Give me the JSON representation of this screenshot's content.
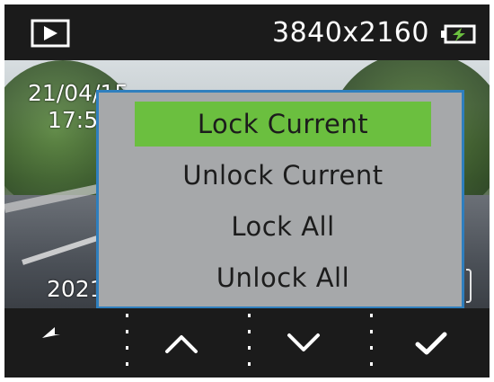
{
  "status_bar": {
    "mode_icon": "play-icon",
    "resolution": "3840x2160",
    "battery_icon": "battery-charging-icon",
    "battery_color": "#6bbf3f"
  },
  "video_overlay": {
    "date_text": "21/04/15",
    "time_text": "17:5",
    "year_text": "2021"
  },
  "menu": {
    "items": [
      {
        "label": "Lock Current",
        "selected": true
      },
      {
        "label": "Unlock Current",
        "selected": false
      },
      {
        "label": "Lock All",
        "selected": false
      },
      {
        "label": "Unlock All",
        "selected": false
      }
    ],
    "selected_color": "#6bbf3f",
    "border_color": "#2f7fbe"
  },
  "bottom_bar": {
    "buttons": [
      {
        "icon": "back-arrow-icon"
      },
      {
        "icon": "chevron-up-icon"
      },
      {
        "icon": "chevron-down-icon"
      },
      {
        "icon": "checkmark-icon"
      }
    ]
  }
}
